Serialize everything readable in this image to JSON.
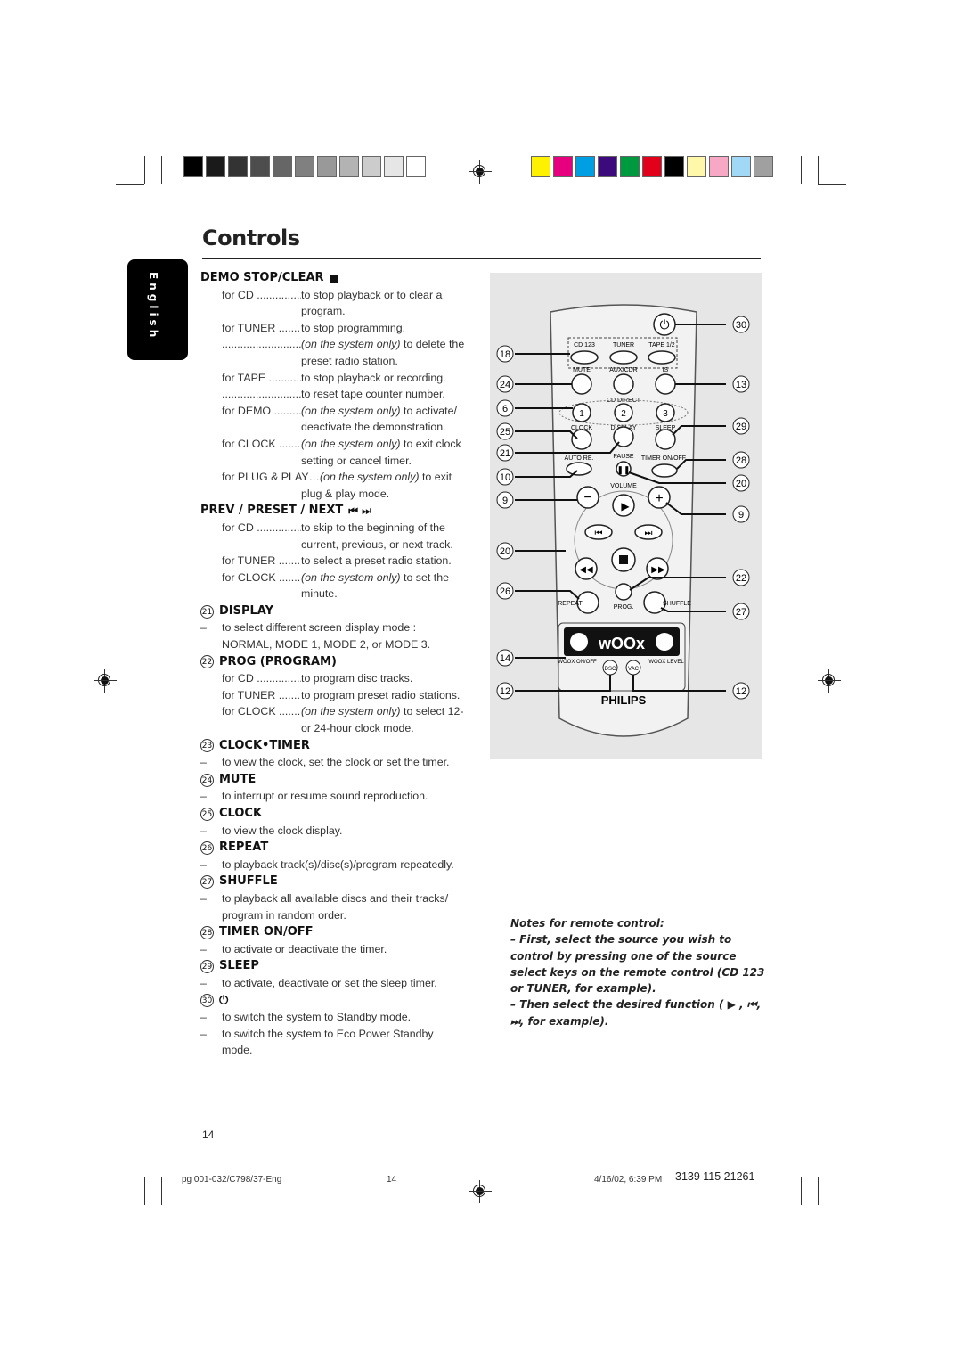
{
  "page": {
    "title": "Controls",
    "language_tab": "English",
    "page_number": "14"
  },
  "color_bars": {
    "grayscale": [
      "#000000",
      "#1a1a1a",
      "#333333",
      "#4d4d4d",
      "#666666",
      "#808080",
      "#999999",
      "#b3b3b3",
      "#cccccc",
      "#e6e6e6",
      "#ffffff"
    ],
    "colors": [
      "#fff200",
      "#e6007e",
      "#009fe3",
      "#3c0a7d",
      "#009a3e",
      "#e2001a",
      "#000000",
      "#fff8aa",
      "#f7a8c4",
      "#a0d8f5",
      "#a0a0a0"
    ]
  },
  "sections": {
    "demo": {
      "heading": "DEMO STOP/CLEAR",
      "symbol": "■",
      "rows": [
        {
          "key": "for CD ................",
          "val": "to stop playback or to clear a"
        },
        {
          "key": "",
          "val": "program."
        },
        {
          "key": "for TUNER ........",
          "val": "to stop programming."
        },
        {
          "key": "................................",
          "val_italic": "(on the system only)",
          "val": " to delete the"
        },
        {
          "key": "",
          "val": "preset radio station."
        },
        {
          "key": "for TAPE ............",
          "val": "to stop playback or recording."
        },
        {
          "key": "................................",
          "val": "to reset tape counter number."
        },
        {
          "key": "for DEMO .........",
          "val_italic": "(on the system only)",
          "val": " to activate/"
        },
        {
          "key": "",
          "val": "deactivate the demonstration."
        },
        {
          "key": "for CLOCK .......",
          "val_italic": "(on the system only)",
          "val": " to exit clock"
        },
        {
          "key": "",
          "val": "setting or cancel timer."
        }
      ],
      "plug_line_a": "for PLUG & PLAY…",
      "plug_line_italic": "(on the system only)",
      "plug_line_b": " to exit",
      "plug_line_cont": "plug & play mode."
    },
    "prev": {
      "heading": "PREV / PRESET / NEXT",
      "symbol": "⏮ ⏭",
      "rows": [
        {
          "key": "for CD ................",
          "val": "to skip to the beginning of the"
        },
        {
          "key": "",
          "val": "current, previous, or next track."
        },
        {
          "key": "for TUNER ........",
          "val": "to select a preset radio station."
        },
        {
          "key": "for CLOCK .......",
          "val_italic": "(on the system only)",
          "val": " to set the"
        },
        {
          "key": "",
          "val": "minute."
        }
      ]
    },
    "display": {
      "num": "21",
      "heading": "DISPLAY",
      "lines": [
        "to select different screen display mode :",
        "NORMAL, MODE 1, MODE 2, or MODE 3."
      ]
    },
    "prog": {
      "num": "22",
      "heading": "PROG (PROGRAM)",
      "rows": [
        {
          "key": "for CD ................",
          "val": "to program disc tracks."
        },
        {
          "key": "for TUNER ........",
          "val": "to program preset radio stations."
        },
        {
          "key": "for CLOCK .......",
          "val_italic": "(on the system only)",
          "val": " to select 12-"
        },
        {
          "key": "",
          "val": "or 24-hour clock mode."
        }
      ]
    },
    "clocktimer": {
      "num": "23",
      "heading": "CLOCK•TIMER",
      "lines": [
        "to view the clock, set the clock or set the timer."
      ]
    },
    "mute": {
      "num": "24",
      "heading": "MUTE",
      "lines": [
        "to interrupt or resume sound reproduction."
      ]
    },
    "clock": {
      "num": "25",
      "heading": "CLOCK",
      "lines": [
        "to view the clock display."
      ]
    },
    "repeat": {
      "num": "26",
      "heading": "REPEAT",
      "lines": [
        "to playback track(s)/disc(s)/program repeatedly."
      ]
    },
    "shuffle": {
      "num": "27",
      "heading": "SHUFFLE",
      "lines": [
        "to playback all available discs and their tracks/",
        "program in random order."
      ]
    },
    "timer": {
      "num": "28",
      "heading": "TIMER ON/OFF",
      "lines": [
        "to activate or deactivate the timer."
      ]
    },
    "sleep": {
      "num": "29",
      "heading": "SLEEP",
      "lines": [
        "to activate, deactivate or set the sleep timer."
      ]
    },
    "power": {
      "num": "30",
      "symbol": "⏻",
      "lines": [
        "to switch the system to Standby mode.",
        "to switch the system to Eco Power Standby",
        "mode."
      ]
    }
  },
  "remote": {
    "brand": "PHILIPS",
    "woox_label": "wOOx",
    "buttons": {
      "cd123": "CD 123",
      "tuner": "TUNER",
      "tape": "TAPE 1/2",
      "mute": "MUTE",
      "aux": "AUX/CDR",
      "is": "IS",
      "cd_direct": "CD DIRECT",
      "n1": "1",
      "n2": "2",
      "n3": "3",
      "clock": "CLOCK",
      "display": "DISPLAY",
      "sleep": "SLEEP",
      "autore": "AUTO RE.",
      "pause": "PAUSE",
      "timer": "TIMER ON/OFF",
      "volume": "VOLUME",
      "repeat": "REPEAT",
      "prog": "PROG.",
      "shuffle": "SHUFFLE",
      "woox_onoff": "WOOX ON/OFF",
      "dsc": "DSC",
      "vac": "VAC",
      "woox_level": "WOOX LEVEL"
    },
    "callouts_left": [
      "18",
      "24",
      "6",
      "25",
      "21",
      "10",
      "9",
      "20",
      "26",
      "14",
      "12"
    ],
    "callouts_right": [
      "30",
      "13",
      "29",
      "28",
      "20",
      "9",
      "22",
      "27",
      "12"
    ]
  },
  "notes": {
    "title": "Notes for remote control:",
    "item1": "–  First, select the source you wish to control by pressing one of the source select keys on the remote control (CD 123 or TUNER, for example).",
    "item2": "–  Then select the desired function ( ▶ , ⏮, ⏭, for example)."
  },
  "footer": {
    "file": "pg 001-032/C798/37-Eng",
    "page": "14",
    "date": "4/16/02, 6:39 PM",
    "code": "3139 115 21261"
  }
}
